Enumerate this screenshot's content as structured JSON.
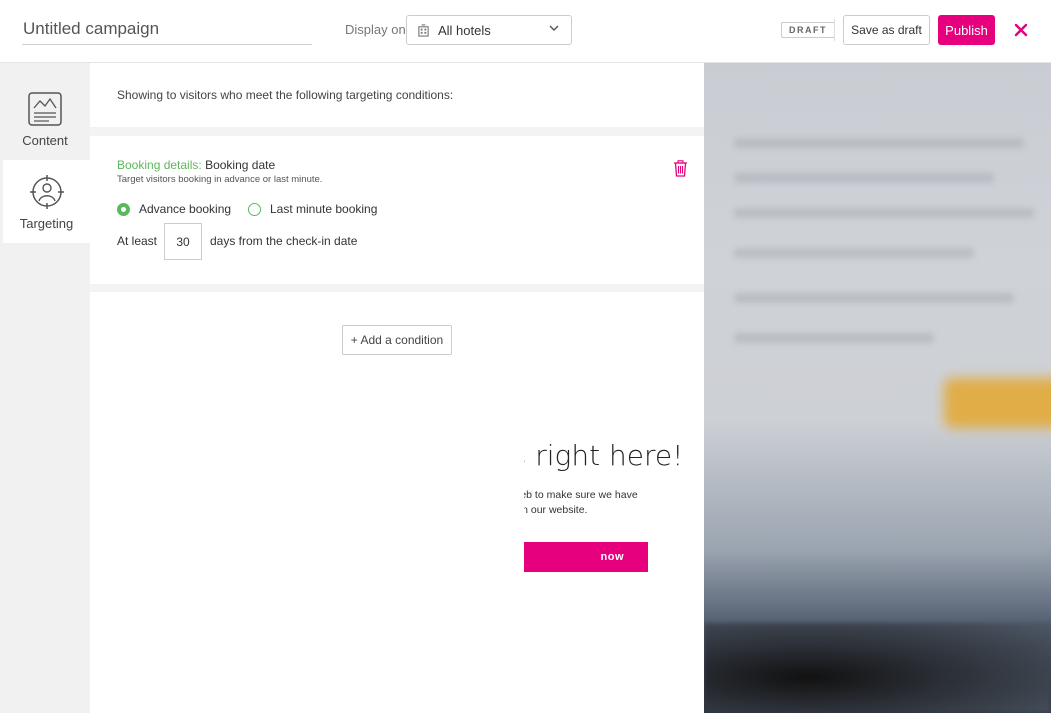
{
  "header": {
    "campaign_name_value": "",
    "campaign_name_placeholder": "Untitled campaign",
    "display_on_label": "Display on",
    "hotel_select_value": "All hotels",
    "draft_badge": "DRAFT",
    "save_draft_label": "Save as draft",
    "publish_label": "Publish"
  },
  "sidebar": {
    "items": [
      {
        "label": "Content",
        "icon": "content-icon",
        "active": false
      },
      {
        "label": "Targeting",
        "icon": "targeting-icon",
        "active": true
      }
    ]
  },
  "main": {
    "intro_text": "Showing to visitors who meet the following targeting conditions:",
    "condition": {
      "category": "Booking details:",
      "name": "Booking date",
      "description": "Target visitors booking in advance or last minute.",
      "options": [
        {
          "label": "Advance booking",
          "selected": true
        },
        {
          "label": "Last minute booking",
          "selected": false
        }
      ],
      "at_least_label": "At least",
      "days_value": "30",
      "days_suffix": "days from the check-in date"
    },
    "add_condition_label": "+ Add a condition"
  },
  "preview": {
    "popup_title": "is right here!",
    "popup_body": "e web to make sure we have\nre on our website.",
    "popup_cta": "now"
  },
  "colors": {
    "accent": "#e6007e",
    "success": "#5cb85c"
  }
}
